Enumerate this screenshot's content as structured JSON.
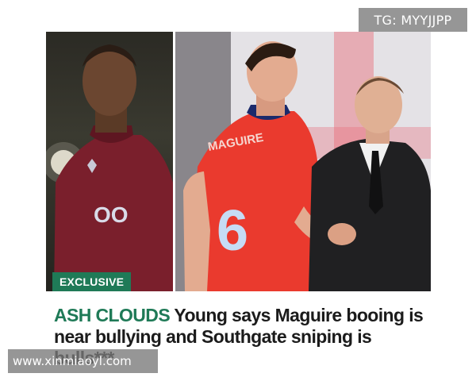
{
  "watermarks": {
    "top": "TG: MYYJJPP",
    "bottom": "www.xinmiaoyl.com"
  },
  "article": {
    "badge": "EXCLUSIVE",
    "kicker": "ASH CLOUDS",
    "headline": " Young says Maguire booing is near bullying and Southgate sniping is bulls***"
  },
  "photos": {
    "left": {
      "description_free": true,
      "shirt_text": "OO",
      "shirt_color": "#7a1f2c"
    },
    "right": {
      "shirt_text": "MAGUIRE",
      "shirt_color": "#ea3a2e",
      "suit_color": "#202022"
    }
  },
  "colors": {
    "accent": "#1f7a57",
    "headline_text": "#1b1b1b"
  }
}
